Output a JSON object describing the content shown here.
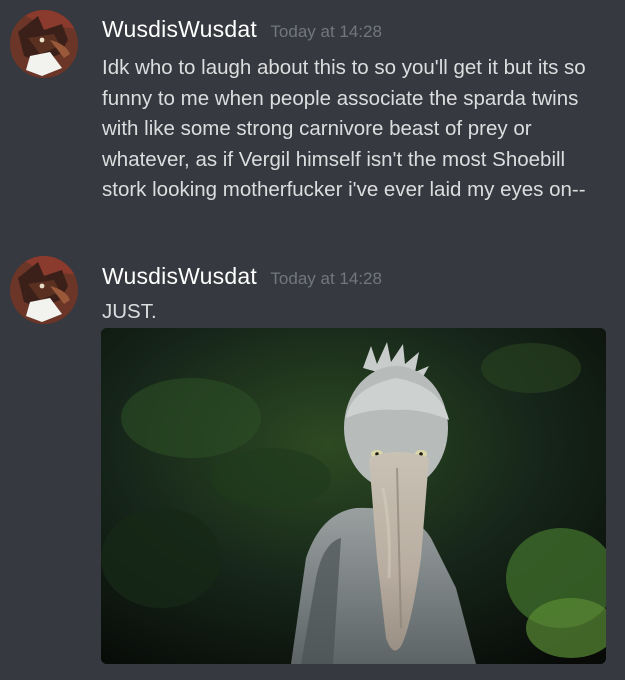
{
  "messages": [
    {
      "username": "WusdisWusdat",
      "timestamp": "Today at 14:28",
      "text": "Idk who to laugh about this to so you'll get it but its so funny to me when people associate the sparda twins with like some strong carnivore beast of prey or whatever, as if Vergil himself isn't the most Shoebill stork looking motherfucker i've ever laid my eyes on--"
    },
    {
      "username": "WusdisWusdat",
      "timestamp": "Today at 14:28",
      "text": "JUST."
    }
  ],
  "attachment": {
    "subject": "shoebill-stork"
  },
  "colors": {
    "background": "#36393f",
    "username": "#ffffff",
    "timestamp": "#72767d",
    "message_text": "#dcddde"
  }
}
